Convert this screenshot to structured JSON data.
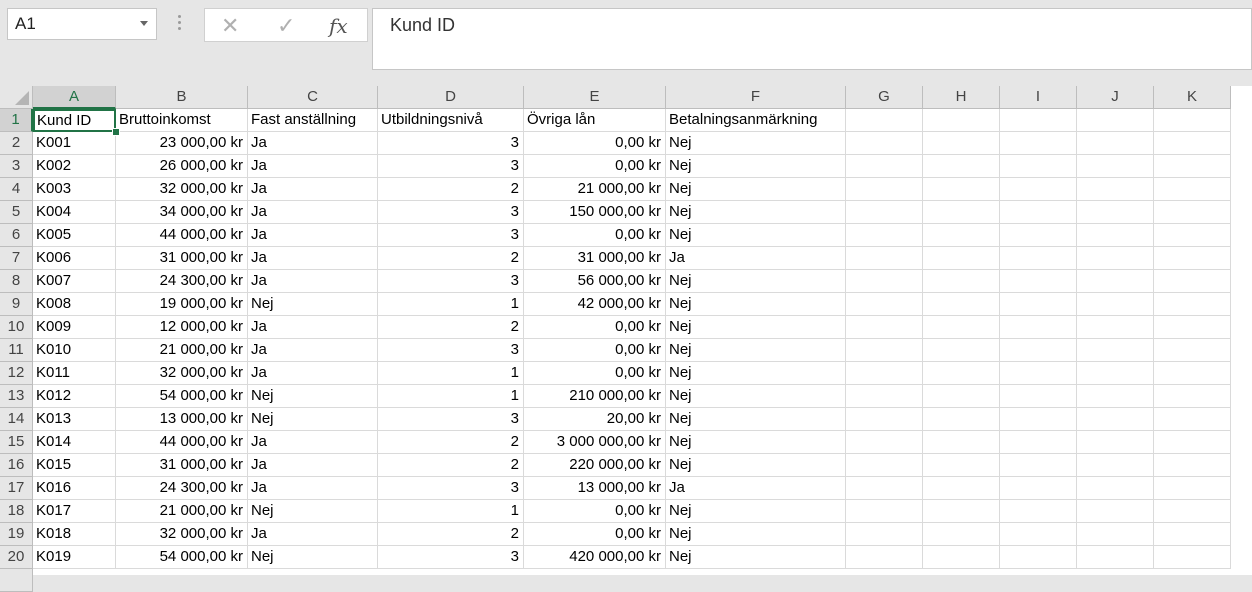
{
  "name_box": {
    "value": "A1"
  },
  "formula_bar": {
    "cancel_glyph": "✕",
    "enter_glyph": "✓",
    "fx_label": "fx",
    "content": "Kund ID"
  },
  "sheet": {
    "selected_cell": "A1",
    "accent_color": "#217346",
    "columns": [
      "A",
      "B",
      "C",
      "D",
      "E",
      "F",
      "G",
      "H",
      "I",
      "J",
      "K"
    ],
    "rows": [
      [
        "Kund ID",
        "Bruttoinkomst",
        "Fast anställning",
        "Utbildningsnivå",
        "Övriga lån",
        "Betalningsanmärkning"
      ],
      [
        "K001",
        "23 000,00 kr",
        "Ja",
        "3",
        "0,00 kr",
        "Nej"
      ],
      [
        "K002",
        "26 000,00 kr",
        "Ja",
        "3",
        "0,00 kr",
        "Nej"
      ],
      [
        "K003",
        "32 000,00 kr",
        "Ja",
        "2",
        "21 000,00 kr",
        "Nej"
      ],
      [
        "K004",
        "34 000,00 kr",
        "Ja",
        "3",
        "150 000,00 kr",
        "Nej"
      ],
      [
        "K005",
        "44 000,00 kr",
        "Ja",
        "3",
        "0,00 kr",
        "Nej"
      ],
      [
        "K006",
        "31 000,00 kr",
        "Ja",
        "2",
        "31 000,00 kr",
        "Ja"
      ],
      [
        "K007",
        "24 300,00 kr",
        "Ja",
        "3",
        "56 000,00 kr",
        "Nej"
      ],
      [
        "K008",
        "19 000,00 kr",
        "Nej",
        "1",
        "42 000,00 kr",
        "Nej"
      ],
      [
        "K009",
        "12 000,00 kr",
        "Ja",
        "2",
        "0,00 kr",
        "Nej"
      ],
      [
        "K010",
        "21 000,00 kr",
        "Ja",
        "3",
        "0,00 kr",
        "Nej"
      ],
      [
        "K011",
        "32 000,00 kr",
        "Ja",
        "1",
        "0,00 kr",
        "Nej"
      ],
      [
        "K012",
        "54 000,00 kr",
        "Nej",
        "1",
        "210 000,00 kr",
        "Nej"
      ],
      [
        "K013",
        "13 000,00 kr",
        "Nej",
        "3",
        "20,00 kr",
        "Nej"
      ],
      [
        "K014",
        "44 000,00 kr",
        "Ja",
        "2",
        "3 000 000,00 kr",
        "Nej"
      ],
      [
        "K015",
        "31 000,00 kr",
        "Ja",
        "2",
        "220 000,00 kr",
        "Nej"
      ],
      [
        "K016",
        "24 300,00 kr",
        "Ja",
        "3",
        "13 000,00 kr",
        "Ja"
      ],
      [
        "K017",
        "21 000,00 kr",
        "Nej",
        "1",
        "0,00 kr",
        "Nej"
      ],
      [
        "K018",
        "32 000,00 kr",
        "Ja",
        "2",
        "0,00 kr",
        "Nej"
      ],
      [
        "K019",
        "54 000,00 kr",
        "Nej",
        "3",
        "420 000,00 kr",
        "Nej"
      ]
    ]
  }
}
